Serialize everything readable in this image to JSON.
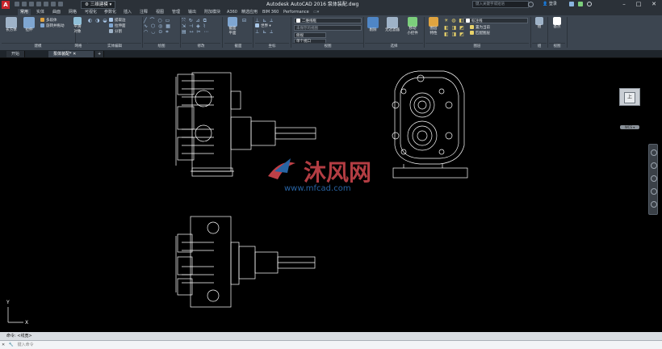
{
  "titlebar": {
    "logo": "A",
    "workspace": "三维建模",
    "title": "Autodesk AutoCAD 2016    泵体装配.dwg",
    "search_placeholder": "键入关键字或短语",
    "signin": "登录"
  },
  "ribbon_tabs": [
    "常用",
    "实体",
    "曲面",
    "网格",
    "可视化",
    "参数化",
    "插入",
    "注释",
    "视图",
    "管理",
    "输出",
    "附加模块",
    "A360",
    "精选应用",
    "BIM 360",
    "Performance"
  ],
  "ribbon": {
    "panel_titles": [
      "建模",
      "网格",
      "实体编辑",
      "绘图",
      "修改",
      "截面",
      "坐标",
      "视图",
      "选择",
      "图层",
      "组",
      "视图"
    ],
    "buttons": {
      "box": "长方体",
      "extrude": "拉伸",
      "smooth": "平滑\n对象",
      "section_plane": "截面\n平面",
      "culling": "剔除",
      "no_filter": "无过滤器",
      "gizmo": "移动\n小控件",
      "layer_props": "图层\n特性",
      "group": "组",
      "base": "基点"
    },
    "modeling_small": [
      "多段体",
      "旋转并拖动"
    ],
    "solid_edit_small": [
      "提取边",
      "拉伸面",
      "分割"
    ],
    "visual_style": "二维线框",
    "view_name": "未保存的视图",
    "view_dropdown": "俯视",
    "viewport_config": "单个视口",
    "layer_dropdown": "标注线",
    "layer_small": [
      "置为当前",
      "匹配图层"
    ],
    "coords_label": "世界",
    "draw_glyphs": [
      "╱ ⌒ ○ ▭",
      "∿ ⬡ ◎ ▦",
      "◠ ◡ ⊙ ⌗"
    ],
    "modify_glyphs": [
      "⤧ ↻ ⊿ ⧉",
      "⇲ ⊣ ◈ ⌇",
      "▤ ⇿ ✂ ⋯"
    ]
  },
  "doc_tabs": [
    "开始",
    "泵体装配*"
  ],
  "watermark": {
    "brand": "沐风网",
    "url": "www.mfcad.com"
  },
  "viewcube": {
    "face": "上",
    "wcs": "WCS ▾"
  },
  "ucs": {
    "x": "X",
    "y": "Y"
  },
  "command": {
    "history": "命令: <线宽>",
    "prompt": "键入命令"
  },
  "colors": {
    "background": "#3c4550",
    "canvas": "#000000",
    "drawing": "#ffffff",
    "autocad_red": "#c9252c",
    "watermark_red": "#d3484f",
    "watermark_blue": "#2d6fb6"
  }
}
